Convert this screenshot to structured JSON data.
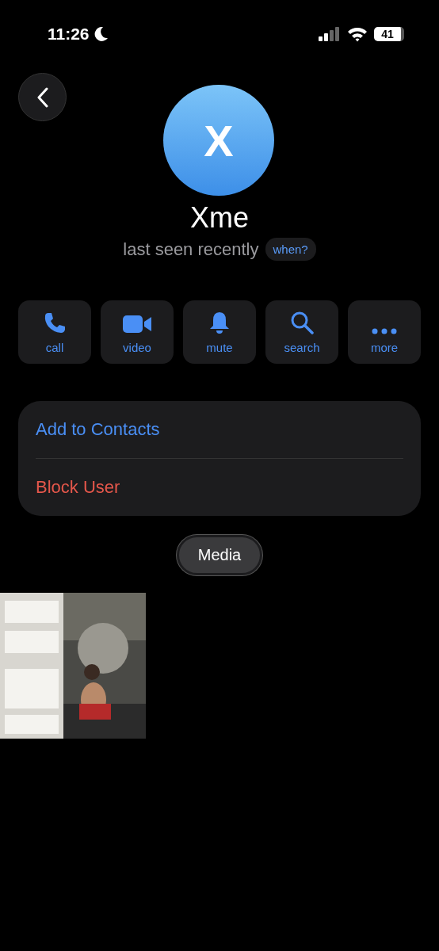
{
  "status_bar": {
    "time": "11:26",
    "battery": "41"
  },
  "profile": {
    "initial": "X",
    "name": "Xme",
    "last_seen": "last seen recently",
    "when_label": "when?"
  },
  "actions": [
    {
      "kind": "call",
      "label": "call"
    },
    {
      "kind": "video",
      "label": "video"
    },
    {
      "kind": "mute",
      "label": "mute"
    },
    {
      "kind": "search",
      "label": "search"
    },
    {
      "kind": "more",
      "label": "more"
    }
  ],
  "options": [
    {
      "label": "Add to Contacts",
      "kind": "normal"
    },
    {
      "label": "Block User",
      "kind": "destructive"
    }
  ],
  "media": {
    "tab": "Media"
  }
}
